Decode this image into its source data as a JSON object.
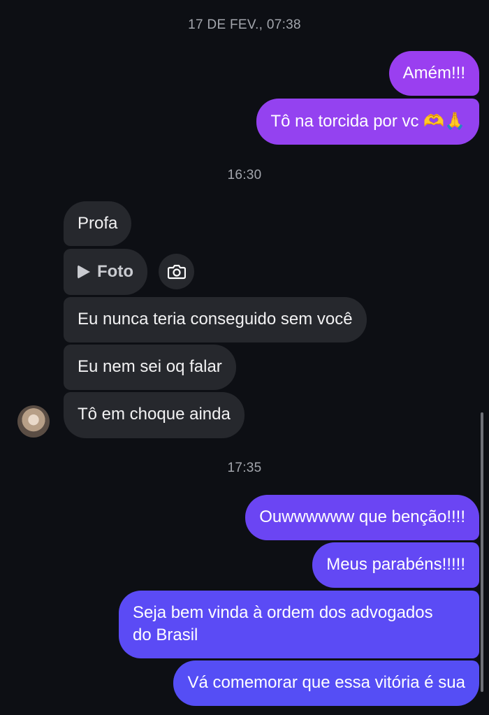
{
  "timestamps": {
    "t1": "17 DE FEV., 07:38",
    "t2": "16:30",
    "t3": "17:35"
  },
  "messages": {
    "out1": "Amém!!!",
    "out2_text": "Tô na torcida por vc",
    "out2_emoji": "🫶🙏",
    "in1": "Profa",
    "in2_photo_label": "Foto",
    "in3": "Eu nunca teria conseguido sem você",
    "in4": "Eu nem sei oq falar",
    "in5": "Tô em choque ainda",
    "out3": "Ouwwwwww que benção!!!!",
    "out4": "Meus parabéns!!!!!",
    "out5_line1": "Seja bem vinda à ordem dos advogados",
    "out5_line2": "do Brasil",
    "out6": "Vá comemorar que essa vitória é sua"
  },
  "colors": {
    "background": "#0d0f14",
    "incoming_bubble": "#26282d",
    "outgoing_gradient_top": "#9b3ff0",
    "outgoing_gradient_bottom": "#5a4ff5"
  },
  "icons": {
    "play": "play-icon",
    "camera": "camera-icon",
    "avatar": "contact-avatar"
  }
}
